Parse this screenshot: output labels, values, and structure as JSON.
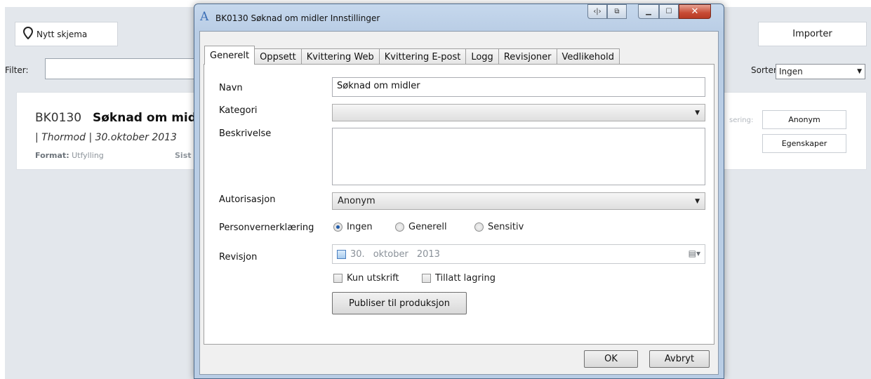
{
  "background": {
    "new_form_button": "Nytt skjema",
    "import_button": "Importer",
    "filter_label": "Filter:",
    "filter_value": "",
    "sort_label": "Sorter:",
    "sort_value": "Ingen",
    "card": {
      "code": "BK0130",
      "title": "Søknad om midl",
      "meta": "| Thormod | 30.oktober 2013",
      "format_label": "Format:",
      "format_value": "Utfylling",
      "sist_label": "Sist",
      "auth_label_partial": "sering:",
      "auth_button": "Anonym",
      "properties_button": "Egenskaper"
    }
  },
  "dialog": {
    "title": "BK0130 Søknad om midler Innstillinger",
    "app_icon": "A",
    "tabs": [
      "Generelt",
      "Oppsett",
      "Kvittering Web",
      "Kvittering E-post",
      "Logg",
      "Revisjoner",
      "Vedlikehold"
    ],
    "active_tab": "Generelt",
    "fields": {
      "navn_label": "Navn",
      "navn_value": "Søknad om midler",
      "kategori_label": "Kategori",
      "kategori_value": "",
      "beskrivelse_label": "Beskrivelse",
      "beskrivelse_value": "",
      "autorisasjon_label": "Autorisasjon",
      "autorisasjon_value": "Anonym",
      "personvern_label": "Personvernerklæring",
      "personvern_options": [
        "Ingen",
        "Generell",
        "Sensitiv"
      ],
      "personvern_selected": "Ingen",
      "revisjon_label": "Revisjon",
      "revisjon_day": "30.",
      "revisjon_month": "oktober",
      "revisjon_year": "2013",
      "kun_utskrift_label": "Kun utskrift",
      "tillatt_lagring_label": "Tillatt lagring",
      "publish_button": "Publiser til produksjon"
    },
    "ok_button": "OK",
    "cancel_button": "Avbryt"
  }
}
